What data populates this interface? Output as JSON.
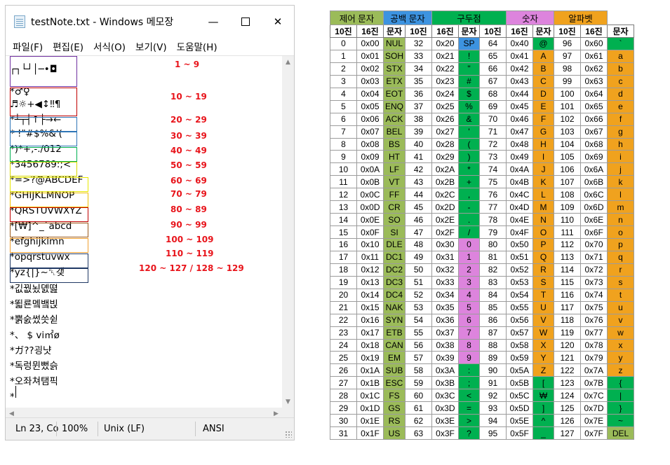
{
  "notepad": {
    "title": "testNote.txt - Windows 메모장",
    "controls": {
      "minimize": "—",
      "close": "✕"
    },
    "menu": [
      "파일(F)",
      "편집(E)",
      "서식(O)",
      "보기(V)",
      "도움말(H)"
    ],
    "lines": [
      "┌┐└┘│─•◘",
      "",
      "*♂♀",
      "♬☼+◀↕‼¶",
      "*┴┬┤↑├→←",
      "* !\"#$%&'(",
      "*)*+,-./012",
      "*3456789:;<",
      "*=>?@ABCDEF",
      "*GHIJKLMNOP",
      "*QRSTUVWXYZ",
      "*[₩]^_`abcd",
      "*efghijklmn",
      "*opqrstuvwx",
      "*yz{|}~␡갲",
      "*깂꿦뇠뎴뗦",
      "*뙯룐멬뱈빉",
      "*뿕숤썼씃쉳",
      "*、 $ vi㎡ø",
      "*ガ??굉냣",
      "*독렁뮌뻤슭",
      "*오좌쳐탬픽",
      "*"
    ],
    "labels": [
      "1 ~ 9",
      "10 ~ 19",
      "20 ~ 29",
      "30 ~ 39",
      "40 ~ 49",
      "50 ~ 59",
      "60 ~ 69",
      "70 ~ 79",
      "80 ~ 89",
      "90 ~ 99",
      "100 ~ 109",
      "110 ~ 119",
      "120 ~ 127 / 128 ~ 129"
    ],
    "box_colors": [
      "#7030a0",
      "#c00000",
      "#2e75b6",
      "#2e75b6",
      "#00b050",
      "#d9d900",
      "#e8e800",
      "#f0c000",
      "#c00000",
      "#9c5a1a",
      "#f0a030",
      "#1f3864",
      "#1f3864"
    ],
    "status": {
      "position": "Ln 23, Co",
      "zoom": "100%",
      "line_ending": "Unix (LF)",
      "encoding": "ANSI"
    }
  },
  "ascii": {
    "group_headers": [
      "제어 문자",
      "공백 문자",
      "구두점",
      "숫자",
      "알파벳"
    ],
    "column_headers": [
      "10진",
      "16진",
      "문자",
      "10진",
      "16진",
      "문자",
      "10진",
      "16진",
      "문자",
      "10진",
      "16진",
      "문자"
    ],
    "colors": {
      "control": "#9bbb59",
      "space": "#3d93e0",
      "punct": "#00b050",
      "digit": "#dd84dd",
      "alpha": "#f0a21e",
      "group_control": "#9bbb59",
      "group_space": "#3d93e0",
      "group_punct": "#00b050",
      "group_digit": "#dd84dd",
      "group_alpha": "#f0a21e"
    },
    "control_names": [
      "NUL",
      "SOH",
      "STX",
      "ETX",
      "EOT",
      "ENQ",
      "ACK",
      "BEL",
      "BS",
      "HT",
      "LF",
      "VT",
      "FF",
      "CR",
      "SO",
      "SI",
      "DLE",
      "DC1",
      "DC2",
      "DC3",
      "DC4",
      "NAK",
      "SYN",
      "ETB",
      "CAN",
      "EM",
      "SUB",
      "ESC",
      "FS",
      "GS",
      "RS",
      "US"
    ],
    "col2_chars": [
      "SP",
      "!",
      "\"",
      "#",
      "$",
      "%",
      "&",
      "'",
      "(",
      ")",
      "*",
      "+",
      ",",
      "-",
      ".",
      "/",
      "0",
      "1",
      "2",
      "3",
      "4",
      "5",
      "6",
      "7",
      "8",
      "9",
      ":",
      ";",
      "<",
      "=",
      ">",
      "?"
    ],
    "col3_chars": [
      "@",
      "A",
      "B",
      "C",
      "D",
      "E",
      "F",
      "G",
      "H",
      "I",
      "J",
      "K",
      "L",
      "M",
      "N",
      "O",
      "P",
      "Q",
      "R",
      "S",
      "T",
      "U",
      "V",
      "W",
      "X",
      "Y",
      "Z",
      "[",
      "₩",
      "]",
      "^",
      "_"
    ],
    "col4_chars": [
      "`",
      "a",
      "b",
      "c",
      "d",
      "e",
      "f",
      "g",
      "h",
      "i",
      "j",
      "k",
      "l",
      "m",
      "n",
      "o",
      "p",
      "q",
      "r",
      "s",
      "t",
      "u",
      "v",
      "w",
      "x",
      "y",
      "z",
      "{",
      "|",
      "}",
      "~",
      "DEL"
    ]
  }
}
